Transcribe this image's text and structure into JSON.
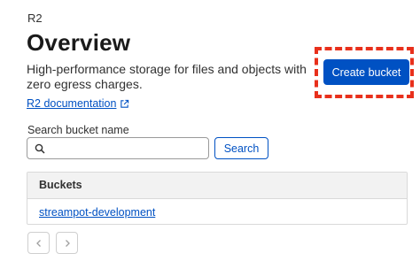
{
  "breadcrumb": "R2",
  "page_title": "Overview",
  "description": "High-performance storage for files and objects with zero egress charges.",
  "doc_link": "R2 documentation",
  "create_button": "Create bucket",
  "search": {
    "label": "Search bucket name",
    "value": "",
    "placeholder": "",
    "button": "Search"
  },
  "table": {
    "header": "Buckets",
    "rows": [
      {
        "name": "streampot-development"
      }
    ]
  },
  "colors": {
    "accent": "#0051c3",
    "highlight": "#e8301c"
  },
  "icons": [
    "external-link-icon",
    "search-icon",
    "chevron-left-icon",
    "chevron-right-icon"
  ]
}
